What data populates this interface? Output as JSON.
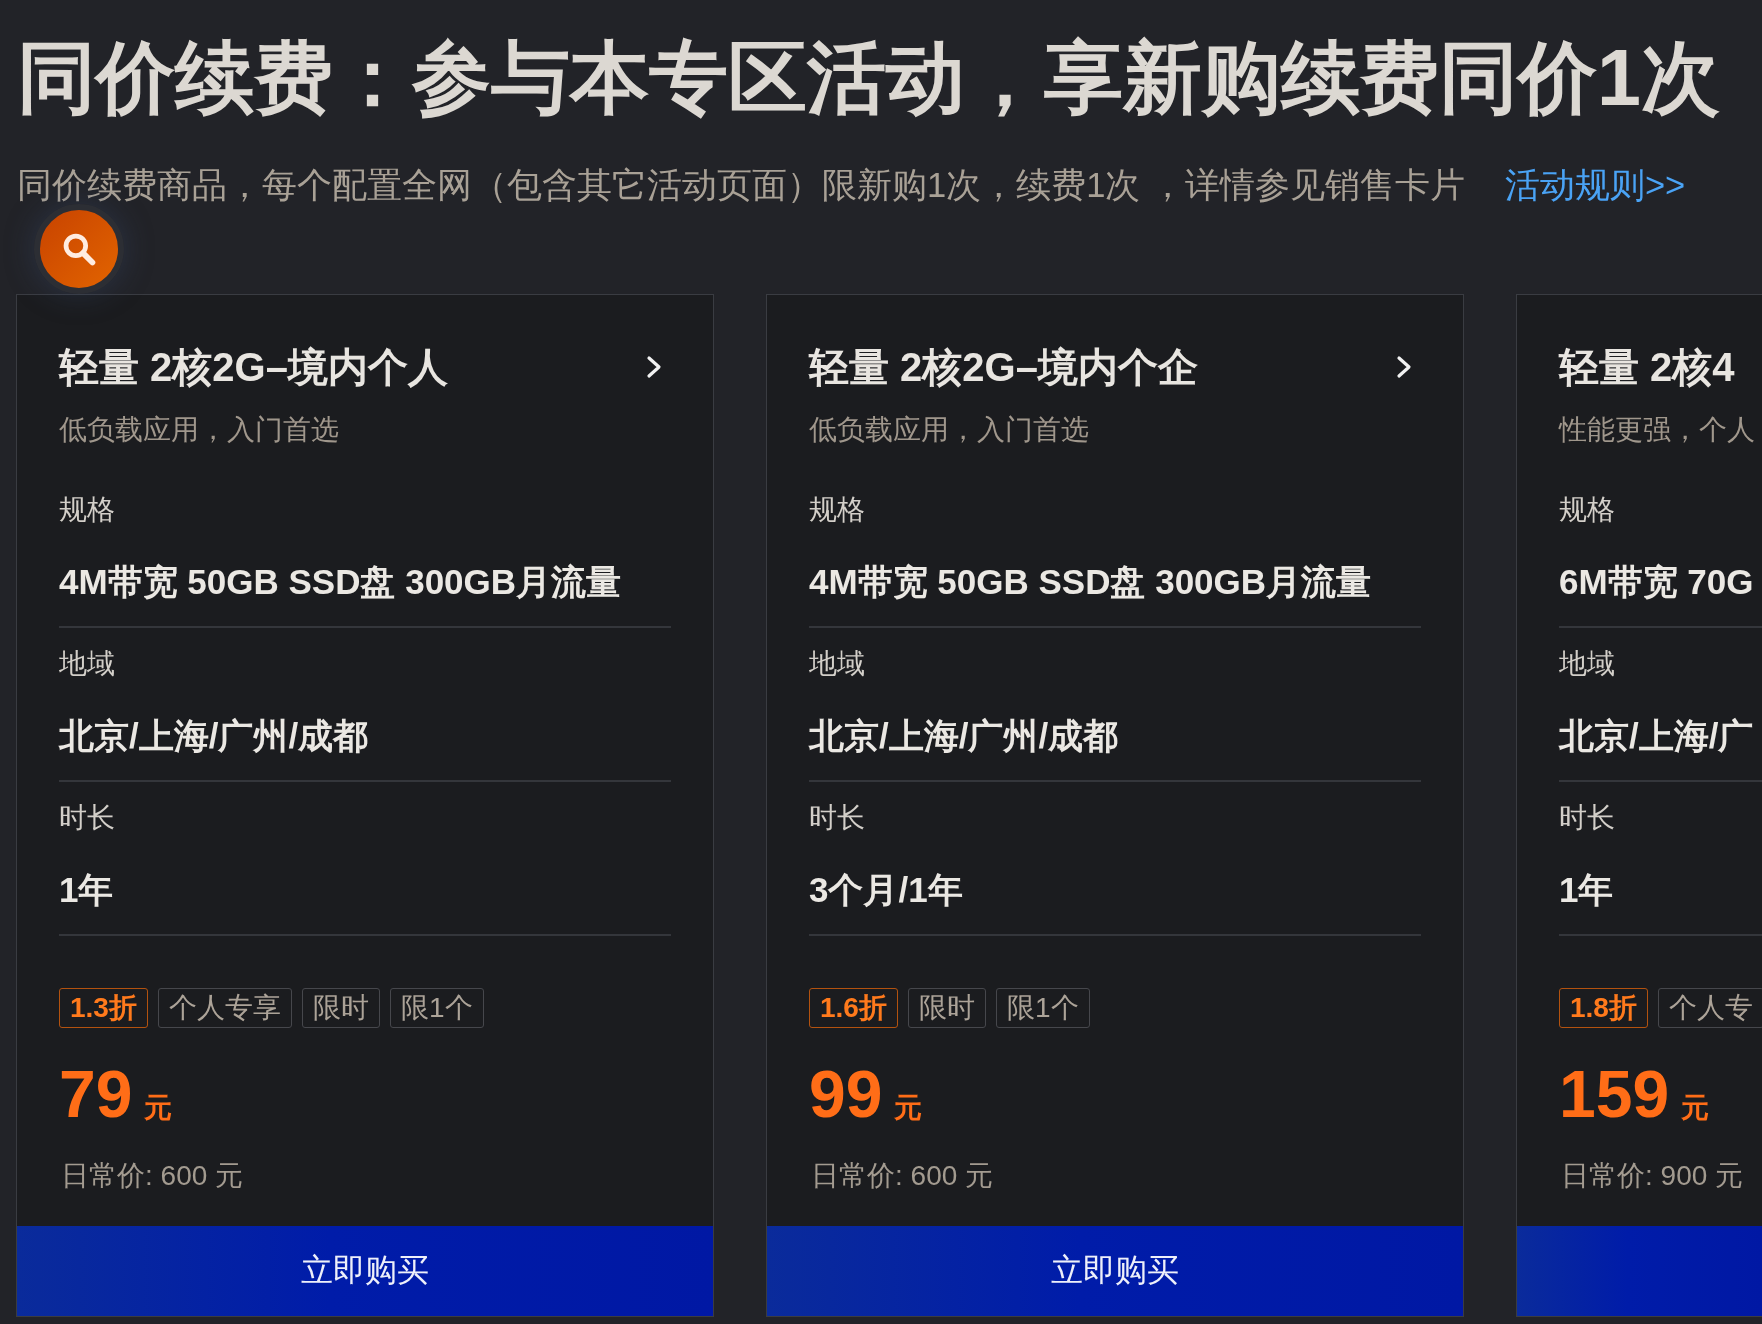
{
  "header": {
    "title": "同价续费：参与本专区活动，享新购续费同价1次",
    "subtitle": "同价续费商品，每个配置全网（包含其它活动页面）限新购1次，续费1次 ，详情参见销售卡片",
    "rules_link": "活动规则>>"
  },
  "cards": [
    {
      "title": "轻量 2核2G–境内个人",
      "description": "低负载应用，入门首选",
      "specs": [
        {
          "label": "规格",
          "value": "4M带宽 50GB SSD盘 300GB月流量"
        },
        {
          "label": "地域",
          "value": "北京/上海/广州/成都"
        },
        {
          "label": "时长",
          "value": "1年"
        }
      ],
      "tags": [
        {
          "kind": "discount",
          "text": "1.3折"
        },
        {
          "kind": "plain",
          "text": "个人专享"
        },
        {
          "kind": "plain",
          "text": "限时"
        },
        {
          "kind": "plain",
          "text": "限1个"
        }
      ],
      "price": "79",
      "currency": "元",
      "regular_price": "日常价: 600 元",
      "button": "立即购买"
    },
    {
      "title": "轻量 2核2G–境内个企",
      "description": "低负载应用，入门首选",
      "specs": [
        {
          "label": "规格",
          "value": "4M带宽 50GB SSD盘 300GB月流量"
        },
        {
          "label": "地域",
          "value": "北京/上海/广州/成都"
        },
        {
          "label": "时长",
          "value": "3个月/1年"
        }
      ],
      "tags": [
        {
          "kind": "discount",
          "text": "1.6折"
        },
        {
          "kind": "plain",
          "text": "限时"
        },
        {
          "kind": "plain",
          "text": "限1个"
        }
      ],
      "price": "99",
      "currency": "元",
      "regular_price": "日常价: 600 元",
      "button": "立即购买"
    },
    {
      "title": "轻量 2核4",
      "description": "性能更强，个人",
      "specs": [
        {
          "label": "规格",
          "value": "6M带宽 70G"
        },
        {
          "label": "地域",
          "value": "北京/上海/广"
        },
        {
          "label": "时长",
          "value": "1年"
        }
      ],
      "tags": [
        {
          "kind": "discount",
          "text": "1.8折"
        },
        {
          "kind": "plain",
          "text": "个人专"
        }
      ],
      "price": "159",
      "currency": "元",
      "regular_price": "日常价: 900 元"
    }
  ]
}
